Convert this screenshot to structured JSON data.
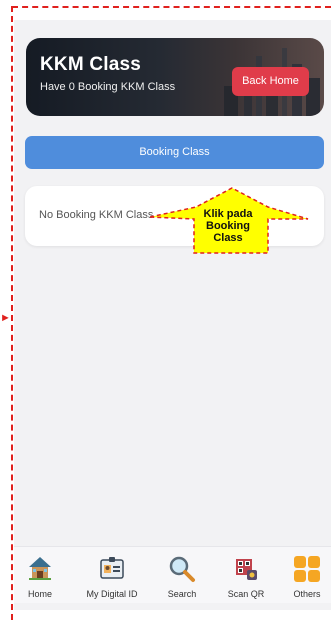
{
  "hero": {
    "title": "KKM Class",
    "subtitle": "Have 0 Booking KKM Class",
    "back_home_label": "Back Home"
  },
  "actions": {
    "booking_class_label": "Booking Class"
  },
  "bookings": {
    "empty_message": "No Booking KKM Class"
  },
  "callout": {
    "line1": "Klik pada",
    "line2": "Booking",
    "line3": "Class"
  },
  "bottom_nav": {
    "items": [
      {
        "label": "Home",
        "icon": "home-icon"
      },
      {
        "label": "My Digital ID",
        "icon": "id-card-icon"
      },
      {
        "label": "Search",
        "icon": "search-icon"
      },
      {
        "label": "Scan QR",
        "icon": "scan-qr-icon"
      },
      {
        "label": "Others",
        "icon": "grid-icon"
      }
    ]
  },
  "colors": {
    "guide": "#e0201d",
    "primary_button": "#4f8ddc",
    "back_home_button": "#e03c4a",
    "callout_fill": "#ffff00"
  }
}
